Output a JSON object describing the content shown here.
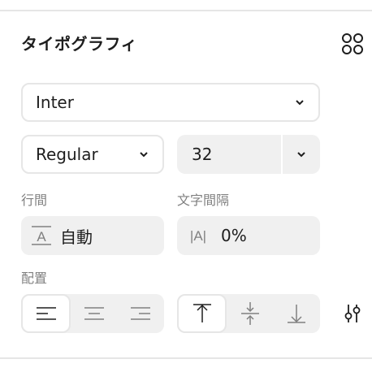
{
  "panel": {
    "title": "タイポグラフィ"
  },
  "font_family": {
    "value": "Inter"
  },
  "font_weight": {
    "value": "Regular"
  },
  "font_size": {
    "value": "32"
  },
  "line_height": {
    "label": "行間",
    "value": "自動",
    "icon_text": "A"
  },
  "letter_spacing": {
    "label": "文字間隔",
    "value": "0%",
    "icon_text": "|A|"
  },
  "alignment": {
    "label": "配置",
    "horizontal": [
      "align-left",
      "align-center",
      "align-right"
    ],
    "horizontal_selected": "align-left",
    "vertical": [
      "align-top",
      "align-middle",
      "align-bottom"
    ],
    "vertical_selected": "align-top"
  },
  "colors": {
    "text": "#1e1e1e",
    "muted": "#808080",
    "field_bg": "#f0f0f0",
    "border": "#e6e6e6"
  }
}
